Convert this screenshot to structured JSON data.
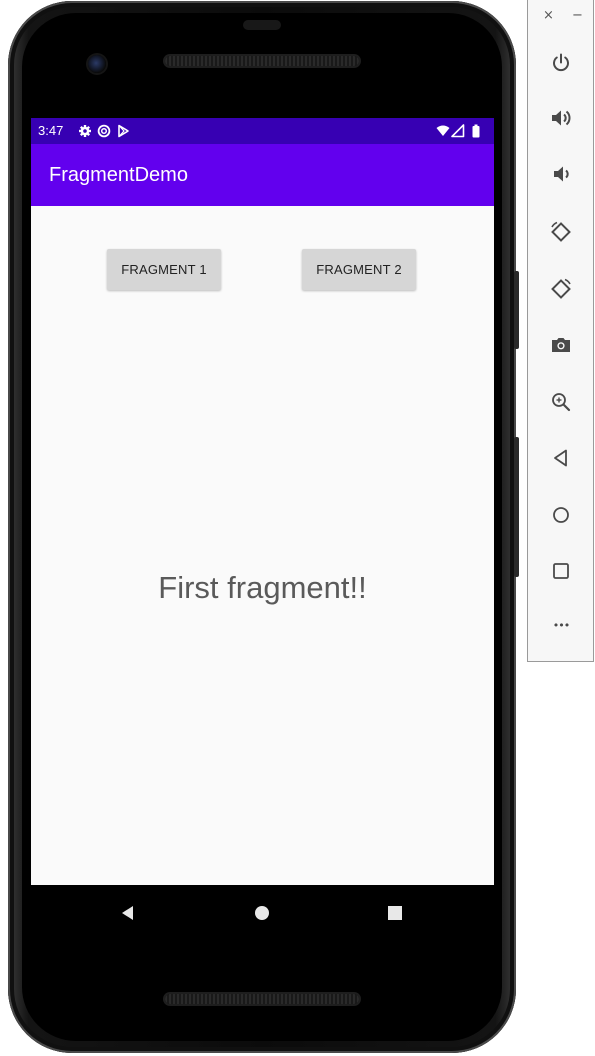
{
  "status_bar": {
    "time": "3:47"
  },
  "app_bar": {
    "title": "FragmentDemo"
  },
  "buttons": {
    "fragment1": "FRAGMENT 1",
    "fragment2": "FRAGMENT 2"
  },
  "fragment": {
    "text": "First fragment!!"
  },
  "emulator_toolbar": {
    "close": "×",
    "minimize": "−",
    "more": "•••"
  },
  "colors": {
    "status_bar": "#3700b3",
    "app_bar": "#6200ee",
    "screen": "#fafafa",
    "toolbar_icons": "#4a4a4a"
  },
  "icons": {
    "status": [
      "gear-icon",
      "data-saver-icon",
      "play-store-icon",
      "wifi-icon",
      "signal-icon",
      "battery-icon"
    ],
    "navigation": [
      "back-icon",
      "home-icon",
      "recents-icon"
    ],
    "toolbar": [
      "power-icon",
      "volume-up-icon",
      "volume-down-icon",
      "rotate-left-icon",
      "rotate-right-icon",
      "camera-icon",
      "zoom-icon",
      "back-icon",
      "home-icon",
      "overview-icon",
      "more-icon"
    ]
  }
}
